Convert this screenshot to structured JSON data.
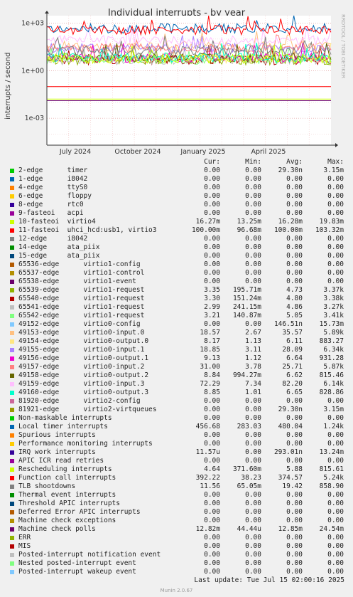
{
  "header": {
    "side_label": "RRDTOOL / TOBI OETIKER",
    "update_text": "Last update: Tue Jul 15 02:00:16 2025",
    "footer": "Munin 2.0.67"
  },
  "chart_data": {
    "type": "line",
    "title": "Individual interrupts - by year",
    "ylabel": "interrupts / second",
    "xlabel": "",
    "yscale": "log",
    "ylim": [
      2e-05,
      3000
    ],
    "y_ticks": [
      {
        "label": "1e+03",
        "value": 1000
      },
      {
        "label": "1e+00",
        "value": 1
      },
      {
        "label": "1e-03",
        "value": 0.001
      }
    ],
    "x_ticks": [
      "July 2024",
      "October 2024",
      "January 2025",
      "April 2025"
    ],
    "grid": true,
    "legend_placement": "bottom",
    "columns": [
      "Cur:",
      "Min:",
      "Avg:",
      "Max:"
    ],
    "series": [
      {
        "name": "2-edge",
        "desc": "timer",
        "color": "#00cc00",
        "cur": "0.00",
        "min": "0.00",
        "avg": "29.30n",
        "max": "3.15m"
      },
      {
        "name": "1-edge",
        "desc": "i8042",
        "color": "#0066b3",
        "cur": "0.00",
        "min": "0.00",
        "avg": "0.00",
        "max": "0.00"
      },
      {
        "name": "4-edge",
        "desc": "ttyS0",
        "color": "#ff8000",
        "cur": "0.00",
        "min": "0.00",
        "avg": "0.00",
        "max": "0.00"
      },
      {
        "name": "6-edge",
        "desc": "floppy",
        "color": "#ffcc00",
        "cur": "0.00",
        "min": "0.00",
        "avg": "0.00",
        "max": "0.00"
      },
      {
        "name": "8-edge",
        "desc": "rtc0",
        "color": "#330099",
        "cur": "0.00",
        "min": "0.00",
        "avg": "0.00",
        "max": "0.00"
      },
      {
        "name": "9-fasteoi",
        "desc": "acpi",
        "color": "#990099",
        "cur": "0.00",
        "min": "0.00",
        "avg": "0.00",
        "max": "0.00"
      },
      {
        "name": "10-fasteoi",
        "desc": "virtio4",
        "color": "#ccff00",
        "cur": "16.27m",
        "min": "13.25m",
        "avg": "16.28m",
        "max": "19.83m"
      },
      {
        "name": "11-fasteoi",
        "desc": "uhci_hcd:usb1, virtio3",
        "color": "#ff0000",
        "cur": "100.00m",
        "min": "96.68m",
        "avg": "100.00m",
        "max": "103.32m"
      },
      {
        "name": "12-edge",
        "desc": "i8042",
        "color": "#808080",
        "cur": "0.00",
        "min": "0.00",
        "avg": "0.00",
        "max": "0.00"
      },
      {
        "name": "14-edge",
        "desc": "ata_piix",
        "color": "#008f00",
        "cur": "0.00",
        "min": "0.00",
        "avg": "0.00",
        "max": "0.00"
      },
      {
        "name": "15-edge",
        "desc": "ata_piix",
        "color": "#00487d",
        "cur": "0.00",
        "min": "0.00",
        "avg": "0.00",
        "max": "0.00"
      },
      {
        "name": "65536-edge",
        "desc": "virtio1-config",
        "color": "#b35a00",
        "cur": "0.00",
        "min": "0.00",
        "avg": "0.00",
        "max": "0.00"
      },
      {
        "name": "65537-edge",
        "desc": "virtio1-control",
        "color": "#b38f00",
        "cur": "0.00",
        "min": "0.00",
        "avg": "0.00",
        "max": "0.00"
      },
      {
        "name": "65538-edge",
        "desc": "virtio1-event",
        "color": "#6b006b",
        "cur": "0.00",
        "min": "0.00",
        "avg": "0.00",
        "max": "0.00"
      },
      {
        "name": "65539-edge",
        "desc": "virtio1-request",
        "color": "#8fb300",
        "cur": "3.35",
        "min": "195.71m",
        "avg": "4.73",
        "max": "3.37k"
      },
      {
        "name": "65540-edge",
        "desc": "virtio1-request",
        "color": "#b30000",
        "cur": "3.30",
        "min": "151.24m",
        "avg": "4.80",
        "max": "3.38k"
      },
      {
        "name": "65541-edge",
        "desc": "virtio1-request",
        "color": "#bebebe",
        "cur": "2.99",
        "min": "241.15m",
        "avg": "4.86",
        "max": "3.27k"
      },
      {
        "name": "65542-edge",
        "desc": "virtio1-request",
        "color": "#80ff80",
        "cur": "3.21",
        "min": "140.87m",
        "avg": "5.05",
        "max": "3.41k"
      },
      {
        "name": "49152-edge",
        "desc": "virtio0-config",
        "color": "#80c9ff",
        "cur": "0.00",
        "min": "0.00",
        "avg": "146.51n",
        "max": "15.73m"
      },
      {
        "name": "49153-edge",
        "desc": "virtio0-input.0",
        "color": "#ffc080",
        "cur": "18.57",
        "min": "2.67",
        "avg": "35.57",
        "max": "5.89k"
      },
      {
        "name": "49154-edge",
        "desc": "virtio0-output.0",
        "color": "#ffe680",
        "cur": "8.17",
        "min": "1.13",
        "avg": "6.11",
        "max": "883.27"
      },
      {
        "name": "49155-edge",
        "desc": "virtio0-input.1",
        "color": "#aa80ff",
        "cur": "18.85",
        "min": "3.11",
        "avg": "28.09",
        "max": "6.34k"
      },
      {
        "name": "49156-edge",
        "desc": "virtio0-output.1",
        "color": "#ee00cc",
        "cur": "9.13",
        "min": "1.12",
        "avg": "6.64",
        "max": "931.28"
      },
      {
        "name": "49157-edge",
        "desc": "virtio0-input.2",
        "color": "#ff8080",
        "cur": "31.00",
        "min": "3.78",
        "avg": "25.71",
        "max": "5.87k"
      },
      {
        "name": "49158-edge",
        "desc": "virtio0-output.2",
        "color": "#666600",
        "cur": "8.84",
        "min": "994.27m",
        "avg": "6.62",
        "max": "815.46"
      },
      {
        "name": "49159-edge",
        "desc": "virtio0-input.3",
        "color": "#ffbfff",
        "cur": "72.29",
        "min": "7.34",
        "avg": "82.20",
        "max": "6.14k"
      },
      {
        "name": "49160-edge",
        "desc": "virtio0-output.3",
        "color": "#00ffcc",
        "cur": "8.85",
        "min": "1.01",
        "avg": "6.65",
        "max": "828.86"
      },
      {
        "name": "81920-edge",
        "desc": "virtio2-config",
        "color": "#cc6699",
        "cur": "0.00",
        "min": "0.00",
        "avg": "0.00",
        "max": "0.00"
      },
      {
        "name": "81921-edge",
        "desc": "virtio2-virtqueues",
        "color": "#999900",
        "cur": "0.00",
        "min": "0.00",
        "avg": "29.30n",
        "max": "3.15m"
      },
      {
        "name": "Non-maskable interrupts",
        "desc": "",
        "color": "#00cc00",
        "cur": "0.00",
        "min": "0.00",
        "avg": "0.00",
        "max": "0.00"
      },
      {
        "name": "Local timer interrupts",
        "desc": "",
        "color": "#0066b3",
        "cur": "456.68",
        "min": "283.03",
        "avg": "480.04",
        "max": "1.24k"
      },
      {
        "name": "Spurious interrupts",
        "desc": "",
        "color": "#ff8000",
        "cur": "0.00",
        "min": "0.00",
        "avg": "0.00",
        "max": "0.00"
      },
      {
        "name": "Performance monitoring interrupts",
        "desc": "",
        "color": "#ffcc00",
        "cur": "0.00",
        "min": "0.00",
        "avg": "0.00",
        "max": "0.00"
      },
      {
        "name": "IRQ work interrupts",
        "desc": "",
        "color": "#330099",
        "cur": "11.57u",
        "min": "0.00",
        "avg": "293.01n",
        "max": "13.24m"
      },
      {
        "name": "APIC ICR read retries",
        "desc": "",
        "color": "#990099",
        "cur": "0.00",
        "min": "0.00",
        "avg": "0.00",
        "max": "0.00"
      },
      {
        "name": "Rescheduling interrupts",
        "desc": "",
        "color": "#ccff00",
        "cur": "4.64",
        "min": "371.60m",
        "avg": "5.88",
        "max": "815.61"
      },
      {
        "name": "Function call interrupts",
        "desc": "",
        "color": "#ff0000",
        "cur": "392.22",
        "min": "38.23",
        "avg": "374.57",
        "max": "5.24k"
      },
      {
        "name": "TLB shootdowns",
        "desc": "",
        "color": "#808080",
        "cur": "11.56",
        "min": "65.05m",
        "avg": "19.42",
        "max": "858.90"
      },
      {
        "name": "Thermal event interrupts",
        "desc": "",
        "color": "#008f00",
        "cur": "0.00",
        "min": "0.00",
        "avg": "0.00",
        "max": "0.00"
      },
      {
        "name": "Threshold APIC interrupts",
        "desc": "",
        "color": "#00487d",
        "cur": "0.00",
        "min": "0.00",
        "avg": "0.00",
        "max": "0.00"
      },
      {
        "name": "Deferred Error APIC interrupts",
        "desc": "",
        "color": "#b35a00",
        "cur": "0.00",
        "min": "0.00",
        "avg": "0.00",
        "max": "0.00"
      },
      {
        "name": "Machine check exceptions",
        "desc": "",
        "color": "#b38f00",
        "cur": "0.00",
        "min": "0.00",
        "avg": "0.00",
        "max": "0.00"
      },
      {
        "name": "Machine check polls",
        "desc": "",
        "color": "#6b006b",
        "cur": "12.82m",
        "min": "44.44u",
        "avg": "12.85m",
        "max": "24.54m"
      },
      {
        "name": "ERR",
        "desc": "",
        "color": "#8fb300",
        "cur": "0.00",
        "min": "0.00",
        "avg": "0.00",
        "max": "0.00"
      },
      {
        "name": "MIS",
        "desc": "",
        "color": "#b30000",
        "cur": "0.00",
        "min": "0.00",
        "avg": "0.00",
        "max": "0.00"
      },
      {
        "name": "Posted-interrupt notification event",
        "desc": "",
        "color": "#bebebe",
        "cur": "0.00",
        "min": "0.00",
        "avg": "0.00",
        "max": "0.00"
      },
      {
        "name": "Nested posted-interrupt event",
        "desc": "",
        "color": "#80ff80",
        "cur": "0.00",
        "min": "0.00",
        "avg": "0.00",
        "max": "0.00"
      },
      {
        "name": "Posted-interrupt wakeup event",
        "desc": "",
        "color": "#80c9ff",
        "cur": "0.00",
        "min": "0.00",
        "avg": "0.00",
        "max": "0.00"
      }
    ]
  }
}
